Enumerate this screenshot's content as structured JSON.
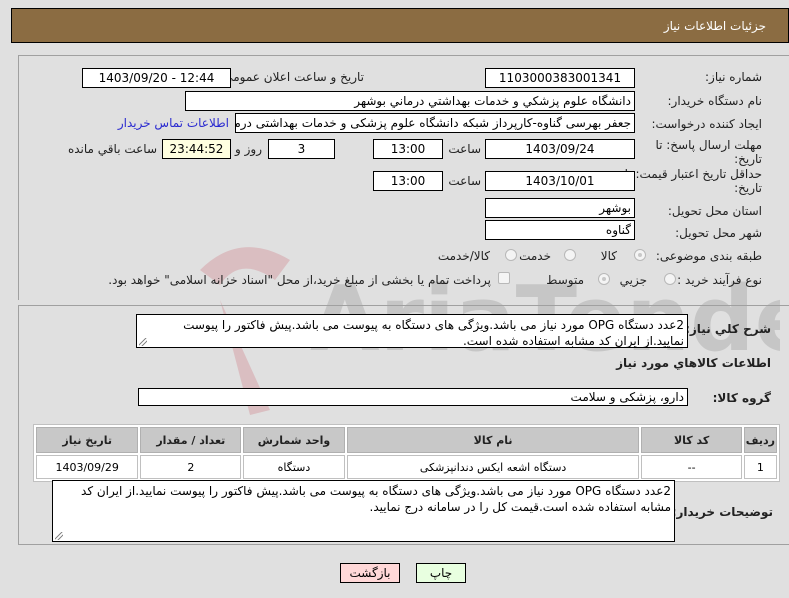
{
  "header": {
    "title": "جزئیات اطلاعات نیاز"
  },
  "form": {
    "need_number": {
      "label": "شماره نیاز:",
      "value": "1103000383001341"
    },
    "announce_datetime": {
      "label": "تاریخ و ساعت اعلان عمومي:",
      "value": "1403/09/20 - 12:44"
    },
    "buyer_org": {
      "label": "نام دستگاه خریدار:",
      "value": "دانشگاه علوم پزشكي و خدمات بهداشتي درماني بوشهر"
    },
    "requester": {
      "label": "ایجاد کننده درخواست:",
      "value": "جعفر بهرسی گناوه-کارپرداز شبکه دانشگاه علوم پزشکی و خدمات بهداشتی درمانی",
      "contact_link": "اطلاعات تماس خریدار"
    },
    "reply_deadline": {
      "label_line1": "مهلت ارسال پاسخ: تا",
      "label_line2": "تاریخ:",
      "date": "1403/09/24",
      "time_label": "ساعت",
      "time": "13:00",
      "days": "3",
      "days_label": "روز و",
      "remaining": "23:44:52",
      "remaining_label": "ساعت باقي مانده"
    },
    "price_validity": {
      "label_line1": "حداقل تاریخ اعتبار قیمت: تا",
      "label_line2": "تاریخ:",
      "date": "1403/10/01",
      "time_label": "ساعت",
      "time": "13:00"
    },
    "province": {
      "label": "استان محل تحویل:",
      "value": "بوشهر"
    },
    "city": {
      "label": "شهر محل تحویل:",
      "value": "گناوه"
    },
    "category": {
      "label": "طبقه بندی موضوعی:",
      "options": [
        {
          "label": "کالا",
          "checked": true
        },
        {
          "label": "خدمت",
          "checked": false
        },
        {
          "label": "کالا/خدمت",
          "checked": false
        }
      ]
    },
    "purchase_type": {
      "label": "نوع فرآیند خرید :",
      "options": [
        {
          "label": "جزیي",
          "checked": false
        },
        {
          "label": "متوسط",
          "checked": true
        }
      ],
      "treasury_checkbox": {
        "label": "پرداخت تمام یا بخشی از مبلغ خرید،از محل \"اسناد خزانه اسلامی\" خواهد بود.",
        "checked": false
      }
    }
  },
  "general_description": {
    "label": "شرح کلي نیاز:",
    "value": "2عدد دستگاه OPG مورد نیاز می باشد.ویژگی های دستگاه به پیوست می باشد.پیش فاکتور را پیوست نمایید.از ایران کد مشابه استفاده شده است."
  },
  "goods_section": {
    "title": "اطلاعات کالاهاي مورد نیاز",
    "group_label": "گروه کالا:",
    "group_value": "دارو، پزشکی و سلامت",
    "table": {
      "headers": [
        "ردیف",
        "کد کالا",
        "نام کالا",
        "واحد شمارش",
        "تعداد / مقدار",
        "تاریخ نیاز"
      ],
      "rows": [
        [
          "1",
          "--",
          "دستگاه اشعه ایکس دندانپزشکی",
          "دستگاه",
          "2",
          "1403/09/29"
        ]
      ]
    }
  },
  "buyer_notes": {
    "label": "توضیحات خریدار:",
    "value": "2عدد دستگاه OPG مورد نیاز می باشد.ویژگی های دستگاه به پیوست می باشد.پیش فاکتور را پیوست نمایید.از ایران کد مشابه استفاده شده است.قیمت کل را در سامانه درج نمایید."
  },
  "buttons": {
    "print": "چاپ",
    "back": "بازگشت"
  },
  "watermark": {
    "text": "AriaTender.neT",
    "color": "#c0283a"
  }
}
